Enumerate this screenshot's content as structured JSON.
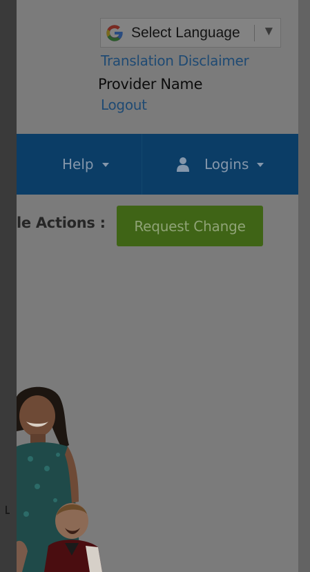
{
  "header": {
    "language_select": {
      "label": "Select Language",
      "google_icon": "google-g-icon",
      "arrow_icon": "dropdown-triangle-icon"
    },
    "translation_disclaimer": "Translation Disclaimer",
    "provider_name": "Provider Name",
    "logout": "Logout"
  },
  "navbar": {
    "help_label": "Help",
    "logins_label": "Logins",
    "user_icon": "user-icon",
    "caret_icon": "caret-down-icon",
    "bg_color": "#0b3d66"
  },
  "actions": {
    "label": "le Actions :",
    "request_change_label": "Request Change",
    "button_color": "#3f6416"
  },
  "overlay": {
    "dim": true
  }
}
